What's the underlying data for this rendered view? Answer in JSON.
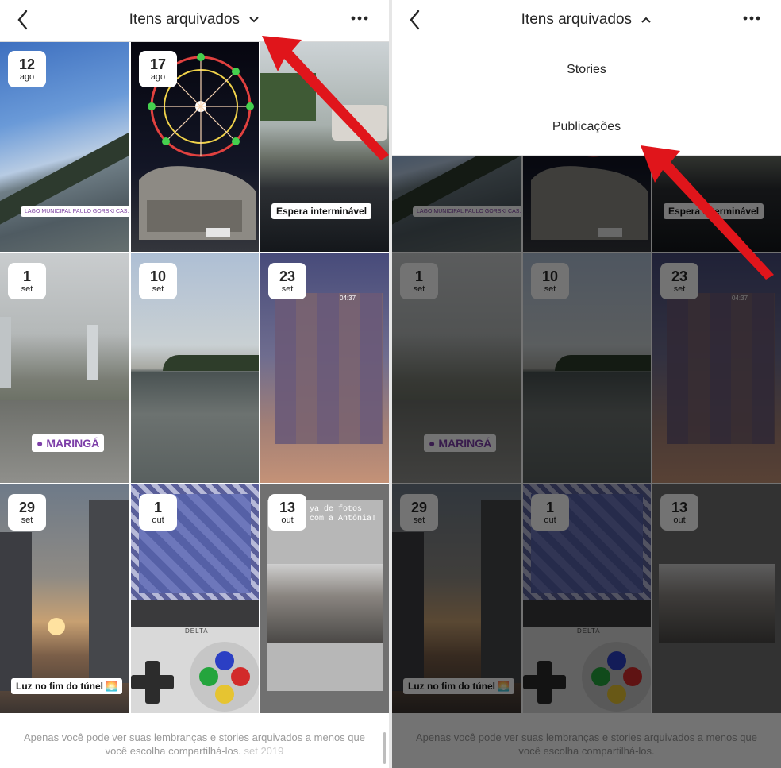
{
  "header": {
    "title": "Itens arquivados"
  },
  "tiles": [
    {
      "day": "12",
      "month": "ago",
      "sticker": "LAGO MUNICIPAL PAULO GORSKI CAS..."
    },
    {
      "day": "17",
      "month": "ago"
    },
    {
      "day": "",
      "month": "",
      "sticker": "Espera interminável"
    },
    {
      "day": "1",
      "month": "set",
      "sticker": "MARINGÁ"
    },
    {
      "day": "10",
      "month": "set"
    },
    {
      "day": "23",
      "month": "set",
      "time": "04:37"
    },
    {
      "day": "29",
      "month": "set",
      "sticker": "Luz no fim do túnel 🌅"
    },
    {
      "day": "1",
      "month": "out",
      "brand": "DELTA"
    },
    {
      "day": "13",
      "month": "out",
      "caption": "Dia de fotos com a Antônia!",
      "caption_visible": "ya de fotos com a Antônia!"
    }
  ],
  "footer": {
    "text": "Apenas você pode ver suas lembranças e stories arquivados a menos que você escolha compartilhá-los.",
    "timestamp": "set 2019"
  },
  "dropdown": {
    "items": [
      "Stories",
      "Publicações"
    ]
  },
  "colors": {
    "accent_arrow": "#e0151b",
    "overlay": "#000000"
  }
}
